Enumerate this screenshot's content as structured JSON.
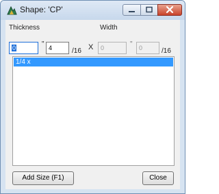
{
  "window": {
    "title": "Shape: 'CP'"
  },
  "labels": {
    "thickness": "Thickness",
    "width": "Width",
    "inch_mark": "\"",
    "sixteenths": "/16",
    "by": "X"
  },
  "thickness": {
    "inches": "0",
    "sixteenths": "4"
  },
  "width": {
    "inches": "0",
    "sixteenths": "0"
  },
  "sizes_list": {
    "items": [
      "1/4 x"
    ],
    "selected_index": 0
  },
  "buttons": {
    "add_size": "Add Size (F1)",
    "close": "Close"
  },
  "colors": {
    "selection": "#3399ff",
    "window_frame": "#d6e3f1",
    "close_button": "#c8432b"
  }
}
